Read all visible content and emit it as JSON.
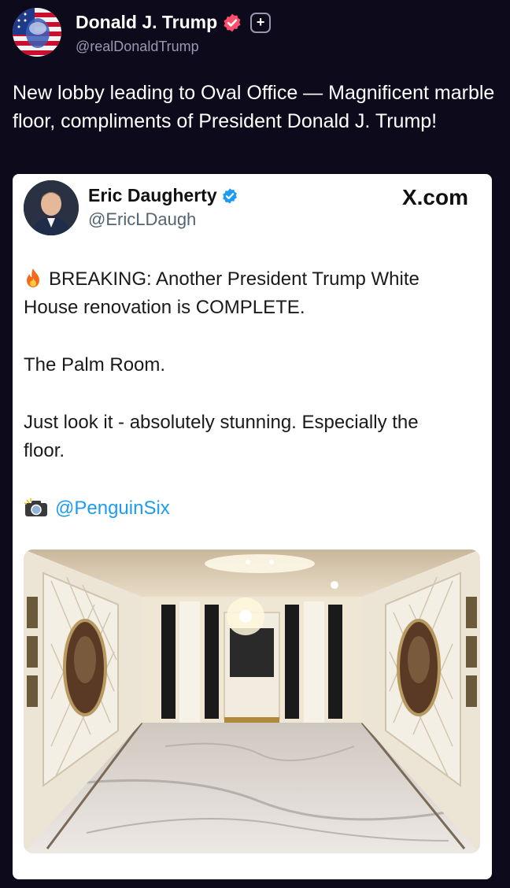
{
  "post": {
    "author_name": "Donald J. Trump",
    "author_handle": "@realDonaldTrump",
    "text": "New lobby leading to Oval Office — Magnificent marble floor, compliments of President Donald J. Trump!"
  },
  "quoted": {
    "author_name": "Eric Daugherty",
    "author_handle": "@EricLDaugh",
    "source": "X.com",
    "line1": "BREAKING: Another President Trump White",
    "line2": "House renovation is COMPLETE.",
    "line3": "The Palm Room.",
    "line4": "Just look it - absolutely stunning. Especially the",
    "line5": "floor.",
    "photo_credit": "@PenguinSix"
  },
  "icons": {
    "main_verified": "verified-badge-icon",
    "follow": "plus-icon",
    "fire": "fire-icon",
    "camera": "camera-flash-icon",
    "quoted_verified": "verified-check-icon"
  },
  "colors": {
    "background": "#0d0a1c",
    "card": "#ffffff",
    "link": "#1d9bf0",
    "verified_main": "#ff4d6d",
    "verified_quoted": "#1d9bf0"
  }
}
